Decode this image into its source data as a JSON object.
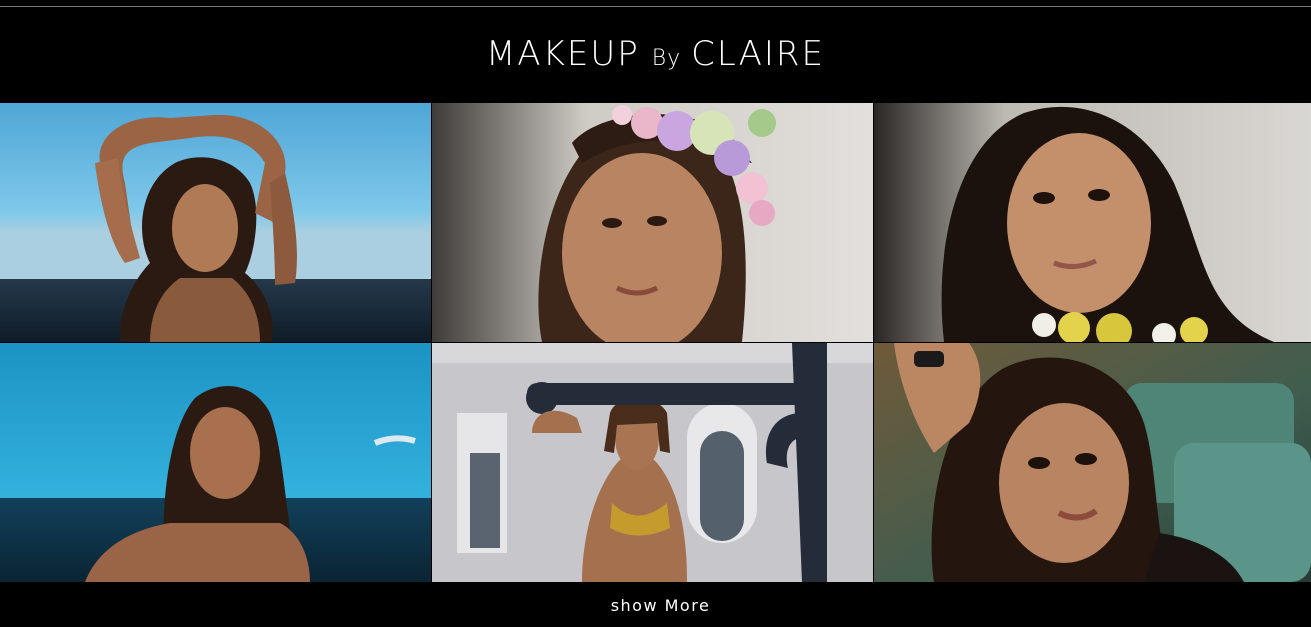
{
  "header": {
    "logo_part1": "MAKEUP",
    "logo_part2": "By",
    "logo_part3": "CLAIRE"
  },
  "gallery": {
    "photos": [
      {
        "subject": "woman with arms raised against blue sky and sea",
        "colors": [
          "#6fc2e6",
          "#1a2a38"
        ]
      },
      {
        "subject": "woman wearing flower crown",
        "colors": [
          "#d9d6d1",
          "#3a2a22"
        ]
      },
      {
        "subject": "woman with long dark hair and yellow flower necklace",
        "colors": [
          "#cfcdc8",
          "#241813"
        ]
      },
      {
        "subject": "woman on beach with blue sea behind",
        "colors": [
          "#2aa7d6",
          "#0c3145"
        ]
      },
      {
        "subject": "woman in yellow bikini holding iron anchor",
        "colors": [
          "#c9c8cc",
          "#1e2735"
        ]
      },
      {
        "subject": "woman with hand in hair, green background",
        "colors": [
          "#47604f",
          "#2b1a12"
        ]
      }
    ]
  },
  "footer": {
    "show_more_label": "show More"
  }
}
